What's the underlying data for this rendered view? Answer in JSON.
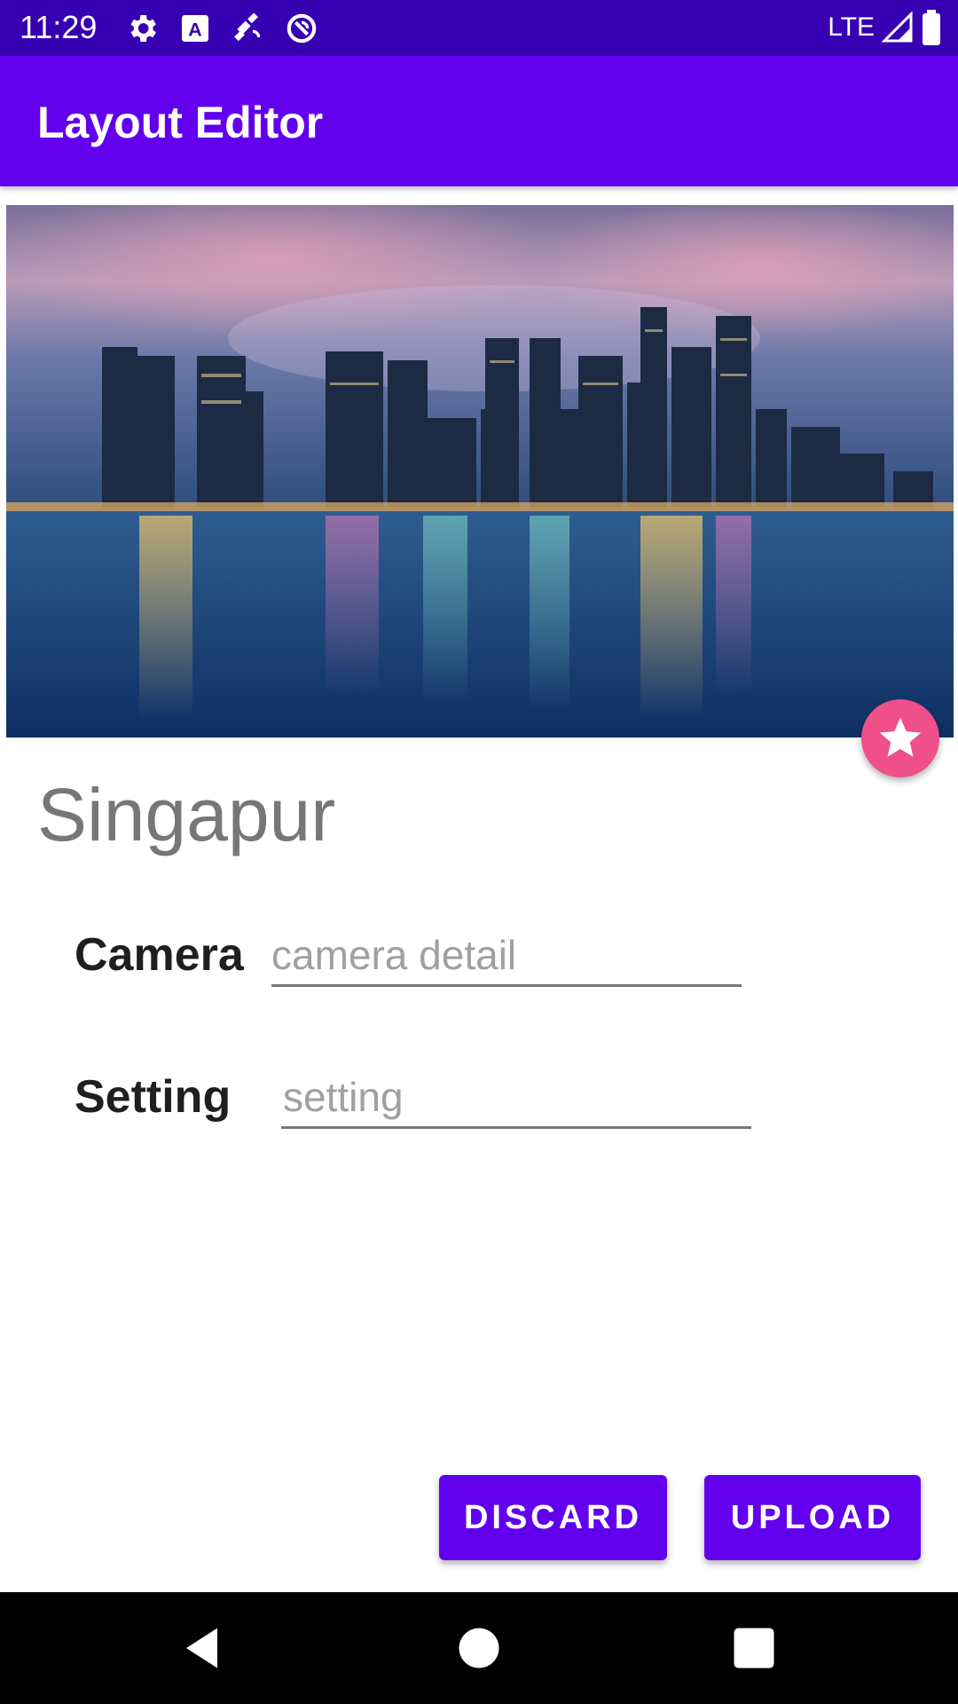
{
  "status_bar": {
    "time": "11:29",
    "network": "LTE",
    "icons": [
      "settings-icon",
      "keyboard-a-icon",
      "satellite-icon",
      "sync-icon"
    ]
  },
  "app_bar": {
    "title": "Layout Editor"
  },
  "hero": {
    "icon": "city-skyline-photo"
  },
  "fab": {
    "icon": "star-icon",
    "color": "#f0508a"
  },
  "place": {
    "title": "Singapur"
  },
  "form": {
    "camera": {
      "label": "Camera",
      "placeholder": "camera detail",
      "value": ""
    },
    "setting": {
      "label": "Setting",
      "placeholder": "setting",
      "value": ""
    }
  },
  "actions": {
    "discard_label": "DISCARD",
    "upload_label": "UPLOAD"
  },
  "colors": {
    "primary": "#6200ee",
    "status_bar": "#3700b3",
    "accent": "#f0508a"
  }
}
